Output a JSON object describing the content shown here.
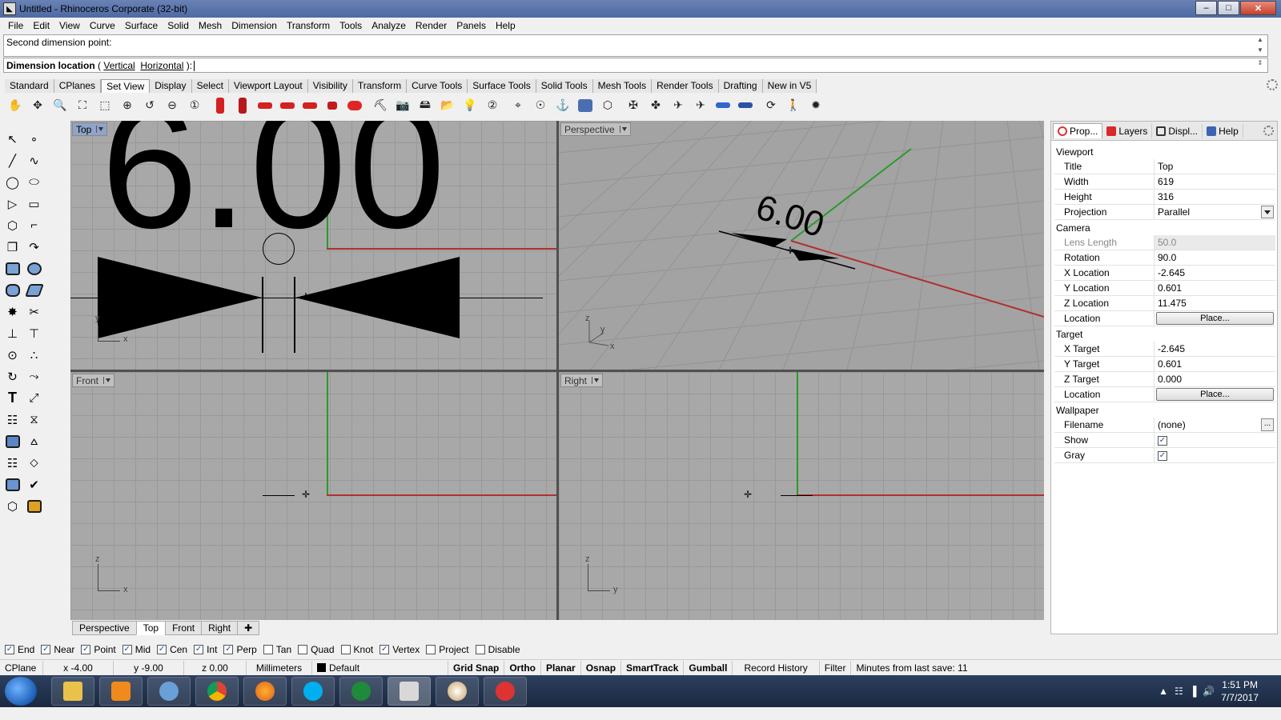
{
  "window": {
    "title": "Untitled - Rhinoceros Corporate (32-bit)"
  },
  "menu": [
    "File",
    "Edit",
    "View",
    "Curve",
    "Surface",
    "Solid",
    "Mesh",
    "Dimension",
    "Transform",
    "Tools",
    "Analyze",
    "Render",
    "Panels",
    "Help"
  ],
  "command": {
    "history": "Second dimension point:",
    "prompt_label": "Dimension location",
    "prompt_open": " ( ",
    "opt_vertical": "Vertical",
    "opt_horizontal": "Horizontal",
    "prompt_close": " ):"
  },
  "toolbar_tabs": [
    "Standard",
    "CPlanes",
    "Set View",
    "Display",
    "Select",
    "Viewport Layout",
    "Visibility",
    "Transform",
    "Curve Tools",
    "Surface Tools",
    "Solid Tools",
    "Mesh Tools",
    "Render Tools",
    "Drafting",
    "New in V5"
  ],
  "toolbar_active": "Set View",
  "viewports": {
    "top": {
      "label": "Top",
      "dim_text": "6.00",
      "axis_x": "x",
      "axis_y": "y"
    },
    "perspective": {
      "label": "Perspective",
      "dim_text": "6.00",
      "axis_x": "x",
      "axis_y": "y",
      "axis_z": "z"
    },
    "front": {
      "label": "Front",
      "axis_x": "x",
      "axis_z": "z"
    },
    "right": {
      "label": "Right",
      "axis_y": "y",
      "axis_z": "z"
    }
  },
  "viewport_tabs": [
    "Perspective",
    "Top",
    "Front",
    "Right"
  ],
  "viewport_tab_active": "Top",
  "panel": {
    "tabs": [
      "Prop...",
      "Layers",
      "Displ...",
      "Help"
    ],
    "sections": {
      "viewport": "Viewport",
      "camera": "Camera",
      "target": "Target",
      "wallpaper": "Wallpaper"
    },
    "viewport_props": [
      {
        "k": "Title",
        "v": "Top"
      },
      {
        "k": "Width",
        "v": "619"
      },
      {
        "k": "Height",
        "v": "316"
      },
      {
        "k": "Projection",
        "v": "Parallel"
      }
    ],
    "camera_props": [
      {
        "k": "Lens Length",
        "v": "50.0"
      },
      {
        "k": "Rotation",
        "v": "90.0"
      },
      {
        "k": "X Location",
        "v": "-2.645"
      },
      {
        "k": "Y Location",
        "v": "0.601"
      },
      {
        "k": "Z Location",
        "v": "11.475"
      },
      {
        "k": "Location",
        "v": "Place..."
      }
    ],
    "target_props": [
      {
        "k": "X Target",
        "v": "-2.645"
      },
      {
        "k": "Y Target",
        "v": "0.601"
      },
      {
        "k": "Z Target",
        "v": "0.000"
      },
      {
        "k": "Location",
        "v": "Place..."
      }
    ],
    "wallpaper_props": [
      {
        "k": "Filename",
        "v": "(none)"
      },
      {
        "k": "Show",
        "v": ""
      },
      {
        "k": "Gray",
        "v": ""
      }
    ],
    "dots": "..."
  },
  "osnaps": [
    {
      "label": "End",
      "checked": true
    },
    {
      "label": "Near",
      "checked": true
    },
    {
      "label": "Point",
      "checked": true
    },
    {
      "label": "Mid",
      "checked": true
    },
    {
      "label": "Cen",
      "checked": true
    },
    {
      "label": "Int",
      "checked": true
    },
    {
      "label": "Perp",
      "checked": true
    },
    {
      "label": "Tan",
      "checked": false
    },
    {
      "label": "Quad",
      "checked": false
    },
    {
      "label": "Knot",
      "checked": false
    },
    {
      "label": "Vertex",
      "checked": true
    },
    {
      "label": "Project",
      "checked": false
    },
    {
      "label": "Disable",
      "checked": false
    }
  ],
  "status": {
    "cplane": "CPlane",
    "x": "x -4.00",
    "y": "y -9.00",
    "z": "z 0.00",
    "units": "Millimeters",
    "layer": "Default",
    "grid_snap": "Grid Snap",
    "ortho": "Ortho",
    "planar": "Planar",
    "osnap": "Osnap",
    "smarttrack": "SmartTrack",
    "gumball": "Gumball",
    "record_history": "Record History",
    "filter": "Filter",
    "last_save": "Minutes from last save: 11"
  },
  "taskbar": {
    "time": "1:51 PM",
    "date": "7/7/2017"
  },
  "colors": {
    "axis_x": "#b03030",
    "axis_y": "#2a9a2a",
    "viewport_bg": "#a8a8a8"
  }
}
